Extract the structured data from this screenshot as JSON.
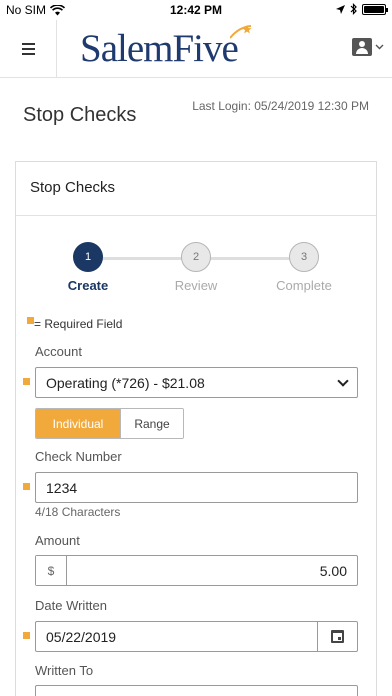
{
  "status_bar": {
    "carrier": "No SIM",
    "time": "12:42 PM"
  },
  "header": {
    "logo_text": "SalemFive",
    "menu_icon": "hamburger-icon",
    "user_icon": "user-account-icon",
    "brand_color": "#1e3a6e",
    "accent_color": "#f2a93b"
  },
  "page": {
    "title": "Stop Checks",
    "last_login": "Last Login: 05/24/2019 12:30 PM"
  },
  "card": {
    "title": "Stop Checks"
  },
  "stepper": {
    "steps": [
      {
        "number": "1",
        "label": "Create",
        "state": "active"
      },
      {
        "number": "2",
        "label": "Review",
        "state": "inactive"
      },
      {
        "number": "3",
        "label": "Complete",
        "state": "inactive"
      }
    ]
  },
  "form": {
    "required_legend": "= Required Field",
    "account": {
      "label": "Account",
      "value": "Operating (*726) - $21.08"
    },
    "mode_toggle": {
      "individual": "Individual",
      "range": "Range",
      "selected": "Individual"
    },
    "check_number": {
      "label": "Check Number",
      "value": "1234",
      "char_count": "4/18 Characters"
    },
    "amount": {
      "label": "Amount",
      "currency_symbol": "$",
      "value": "5.00"
    },
    "date_written": {
      "label": "Date Written",
      "value": "05/22/2019",
      "icon": "calendar-icon"
    },
    "written_to": {
      "label": "Written To"
    }
  }
}
